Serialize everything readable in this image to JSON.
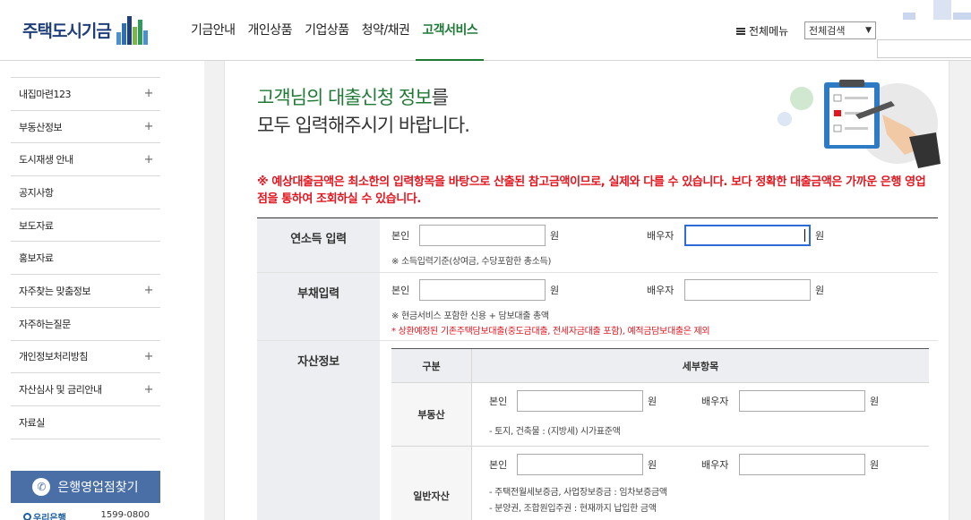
{
  "header": {
    "logo_text": "주택도시기금",
    "nav": [
      "기금안내",
      "개인상품",
      "기업상품",
      "청약/채권",
      "고객서비스"
    ],
    "active_nav": "고객서비스",
    "all_menu": "전체메뉴",
    "search_select": "전체검색"
  },
  "sidebar": {
    "items": [
      {
        "label": "내집마련123",
        "plus": "+"
      },
      {
        "label": "부동산정보",
        "plus": "+"
      },
      {
        "label": "도시재생 안내",
        "plus": "+"
      },
      {
        "label": "공지사항",
        "plus": ""
      },
      {
        "label": "보도자료",
        "plus": ""
      },
      {
        "label": "홍보자료",
        "plus": ""
      },
      {
        "label": "자주찾는 맞춤정보",
        "plus": "+"
      },
      {
        "label": "자주하는질문",
        "plus": ""
      },
      {
        "label": "개인정보처리방침",
        "plus": "+"
      },
      {
        "label": "자산심사 및 금리안내",
        "plus": "+"
      },
      {
        "label": "자료실",
        "plus": ""
      }
    ],
    "branch_button": "은행영업점찾기",
    "bank_name": "우리은행",
    "bank_phone": "1599-0800"
  },
  "main": {
    "title_line1_hl": "고객님의 대출신청 정보",
    "title_line1_rest": "를",
    "title_line2": "모두 입력해주시기 바랍니다.",
    "notice": "※ 예상대출금액은 최소한의 입력항목을 바탕으로 산출된 참고금액이므로, 실제와 다를 수 있습니다. 보다 정확한 대출금액은 가까운 은행 영업점을 통하여 조회하실 수 있습니다.",
    "income": {
      "head": "연소득 입력",
      "self": "본인",
      "spouse": "배우자",
      "unit": "원",
      "note": "※ 소득입력기준(상여금, 수당포함한 총소득)"
    },
    "debt": {
      "head": "부채입력",
      "self": "본인",
      "spouse": "배우자",
      "unit": "원",
      "note": "※ 현금서비스 포함한 신용 + 담보대출 총액",
      "note_red": "* 상환예정된 기존주택담보대출(중도금대출, 전세자금대출 포함), 예적금담보대출은 제외"
    },
    "asset": {
      "head": "자산정보",
      "col1": "구분",
      "col2": "세부항목",
      "rows": [
        {
          "name": "부동산",
          "self": "본인",
          "spouse": "배우자",
          "unit": "원",
          "notes": [
            "- 토지, 건축물 : (지방세) 시가표준액"
          ]
        },
        {
          "name": "일반자산",
          "self": "본인",
          "spouse": "배우자",
          "unit": "원",
          "notes": [
            "- 주택전월세보증금, 사업장보증금 : 임차보증금액",
            "- 분양권, 조합원입주권 : 현재까지 납입한 금액"
          ]
        }
      ]
    }
  },
  "colors": {
    "brand_green": "#1e7a35",
    "logo_blue": "#1f3f7a",
    "notice_red": "#e2161f",
    "button_blue": "#4a6fa6"
  }
}
